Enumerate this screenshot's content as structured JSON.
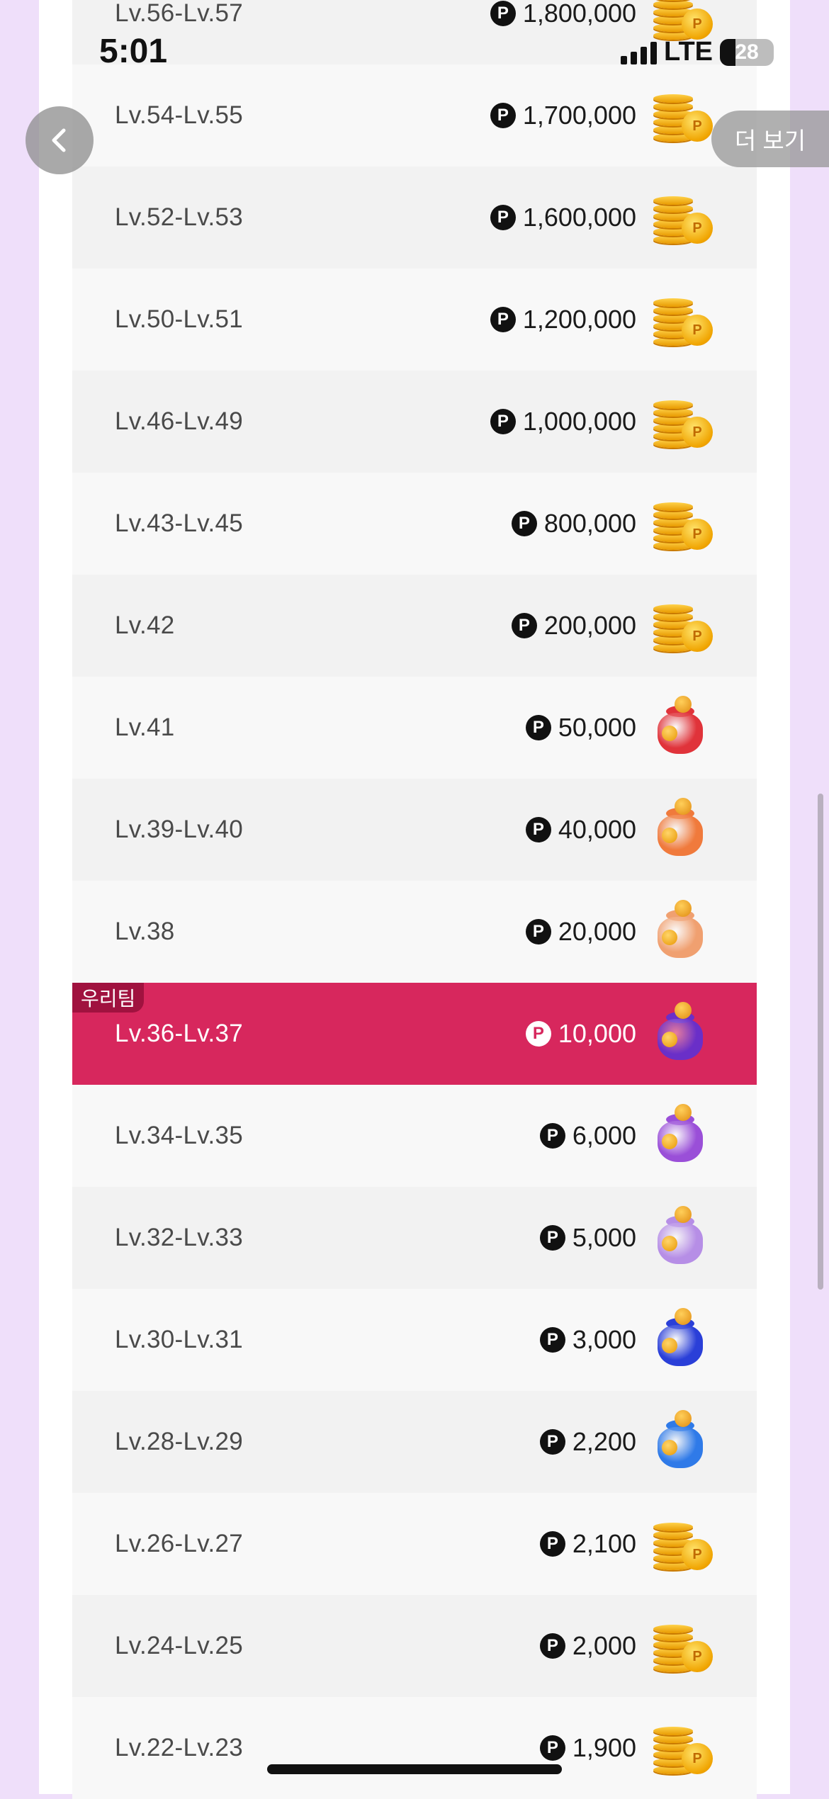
{
  "status_bar": {
    "time": "5:01",
    "network": "LTE",
    "battery": "28"
  },
  "header": {
    "more_label": "더 보기"
  },
  "team_tag": "우리팀",
  "rows": [
    {
      "level": "Lv.56-Lv.57",
      "amount": "1,800,000",
      "icon": "coin-stack-icon"
    },
    {
      "level": "Lv.54-Lv.55",
      "amount": "1,700,000",
      "icon": "coin-stack-icon"
    },
    {
      "level": "Lv.52-Lv.53",
      "amount": "1,600,000",
      "icon": "coin-stack-icon"
    },
    {
      "level": "Lv.50-Lv.51",
      "amount": "1,200,000",
      "icon": "coin-stack-icon"
    },
    {
      "level": "Lv.46-Lv.49",
      "amount": "1,000,000",
      "icon": "coin-stack-icon"
    },
    {
      "level": "Lv.43-Lv.45",
      "amount": "800,000",
      "icon": "coin-stack-icon"
    },
    {
      "level": "Lv.42",
      "amount": "200,000",
      "icon": "coin-stack-icon"
    },
    {
      "level": "Lv.41",
      "amount": "50,000",
      "icon": "red-pouch-icon"
    },
    {
      "level": "Lv.39-Lv.40",
      "amount": "40,000",
      "icon": "orange-pouch-icon"
    },
    {
      "level": "Lv.38",
      "amount": "20,000",
      "icon": "peach-pouch-icon"
    },
    {
      "level": "Lv.36-Lv.37",
      "amount": "10,000",
      "icon": "purple-pouch-icon",
      "highlight": true
    },
    {
      "level": "Lv.34-Lv.35",
      "amount": "6,000",
      "icon": "violet-pouch-icon"
    },
    {
      "level": "Lv.32-Lv.33",
      "amount": "5,000",
      "icon": "lavender-pouch-icon"
    },
    {
      "level": "Lv.30-Lv.31",
      "amount": "3,000",
      "icon": "blue-pouch-icon"
    },
    {
      "level": "Lv.28-Lv.29",
      "amount": "2,200",
      "icon": "sky-pouch-icon"
    },
    {
      "level": "Lv.26-Lv.27",
      "amount": "2,100",
      "icon": "coin-stack-icon"
    },
    {
      "level": "Lv.24-Lv.25",
      "amount": "2,000",
      "icon": "coin-stack-icon"
    },
    {
      "level": "Lv.22-Lv.23",
      "amount": "1,900",
      "icon": "coin-stack-icon"
    }
  ],
  "colors": {
    "highlight": "#d7275d",
    "team_tag": "#a0123f",
    "page_bg": "#efdffa"
  },
  "pouch_colors": {
    "red-pouch-icon": "#e0333a",
    "orange-pouch-icon": "#f07a3c",
    "peach-pouch-icon": "#f0a070",
    "purple-pouch-icon": "#6a2fc8",
    "violet-pouch-icon": "#9a4fd8",
    "lavender-pouch-icon": "#b68ee6",
    "blue-pouch-icon": "#2a3fd8",
    "sky-pouch-icon": "#2f7ae8"
  }
}
